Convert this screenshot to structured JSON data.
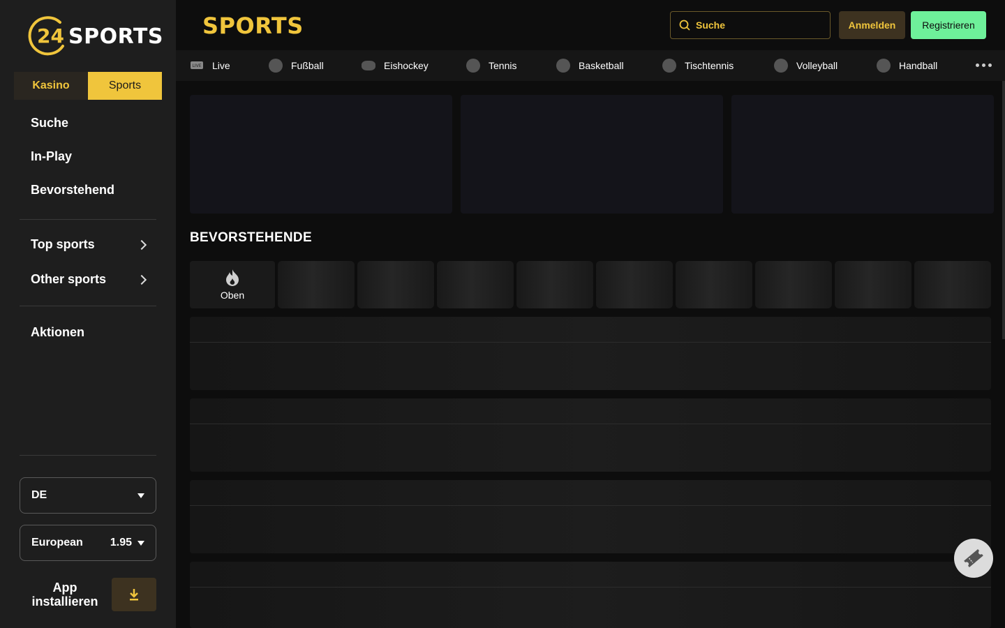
{
  "brand": {
    "logo_number": "24",
    "logo_text": "SPORTS",
    "accent": "#f0c53c",
    "register_color": "#6ef09a"
  },
  "sidebar": {
    "mode_tabs": [
      {
        "label": "Kasino",
        "active": false
      },
      {
        "label": "Sports",
        "active": true
      }
    ],
    "links": [
      "Suche",
      "In-Play",
      "Bevorstehend"
    ],
    "expandables": [
      "Top sports",
      "Other sports"
    ],
    "promotions": "Aktionen",
    "language": "DE",
    "odds_format": {
      "label": "European",
      "value": "1.95"
    },
    "app_install": {
      "line1": "App",
      "line2": "installieren"
    }
  },
  "header": {
    "title": "SPORTS",
    "search_placeholder": "Suche",
    "login_label": "Anmelden",
    "register_label": "Registrieren"
  },
  "sport_nav": [
    {
      "label": "Live",
      "icon": "live-tv-icon"
    },
    {
      "label": "Fußball",
      "icon": "soccer-ball-icon"
    },
    {
      "label": "Eishockey",
      "icon": "hockey-puck-icon"
    },
    {
      "label": "Tennis",
      "icon": "tennis-ball-icon"
    },
    {
      "label": "Basketball",
      "icon": "basketball-icon"
    },
    {
      "label": "Tischtennis",
      "icon": "table-tennis-icon"
    },
    {
      "label": "Volleyball",
      "icon": "volleyball-icon"
    },
    {
      "label": "Handball",
      "icon": "handball-icon"
    }
  ],
  "main": {
    "section_title": "BEVORSTEHENDE",
    "top_chip_label": "Oben"
  }
}
